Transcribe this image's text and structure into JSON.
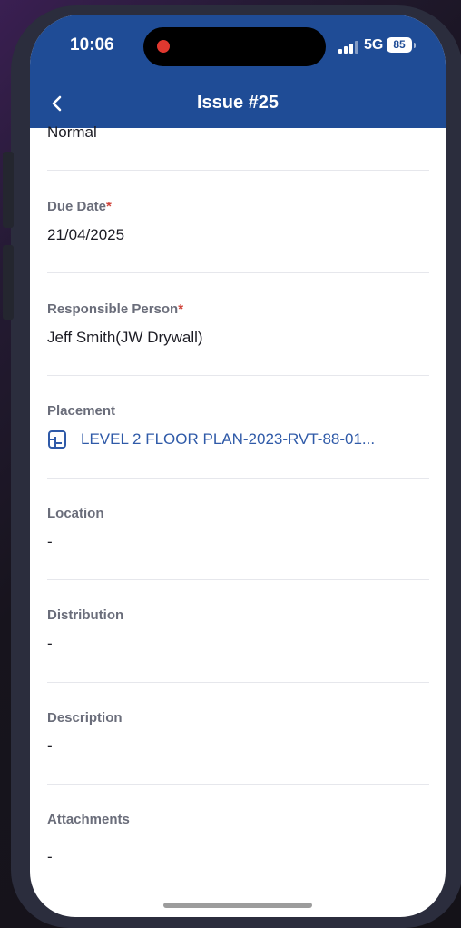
{
  "status_bar": {
    "time": "10:06",
    "network": "5G",
    "battery": "85"
  },
  "header": {
    "title": "Issue #25",
    "back_icon": "chevron-left-icon"
  },
  "colors": {
    "header_bg": "#1f4c96",
    "link": "#2f5aa8",
    "required_asterisk": "#d0443b",
    "label": "#6a6d7a"
  },
  "fields": {
    "priority_value": "Normal",
    "due_date": {
      "label": "Due Date",
      "required": "*",
      "value": "21/04/2025"
    },
    "responsible_person": {
      "label": "Responsible Person",
      "required": "*",
      "value": "Jeff Smith(JW Drywall)"
    },
    "placement": {
      "label": "Placement",
      "value": "LEVEL 2 FLOOR PLAN-2023-RVT-88-01...",
      "icon": "floor-plan-icon"
    },
    "location": {
      "label": "Location",
      "value": "-"
    },
    "distribution": {
      "label": "Distribution",
      "value": "-"
    },
    "description": {
      "label": "Description",
      "value": "-"
    },
    "attachments": {
      "label": "Attachments",
      "value": "-"
    }
  }
}
